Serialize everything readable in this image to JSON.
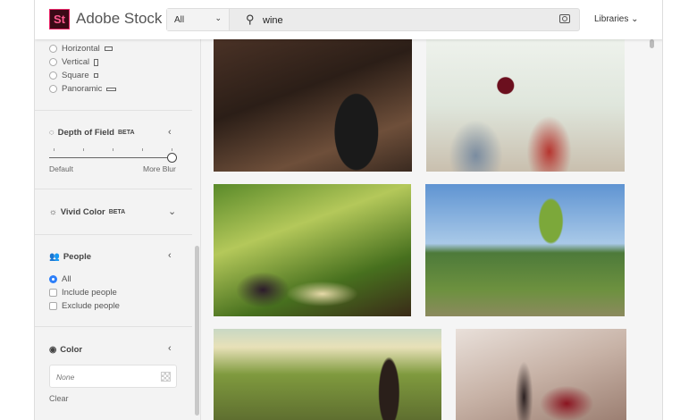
{
  "header": {
    "logo": "St",
    "brand": "Adobe Stock",
    "filter": "All",
    "query": "wine",
    "libraries": "Libraries"
  },
  "sidebar": {
    "orientation": [
      "Horizontal",
      "Vertical",
      "Square",
      "Panoramic"
    ],
    "depth": {
      "title": "Depth of Field",
      "badge": "BETA",
      "min": "Default",
      "max": "More Blur",
      "value": 1.0
    },
    "vivid": {
      "title": "Vivid Color",
      "badge": "BETA"
    },
    "people": {
      "title": "People",
      "options": [
        "All",
        "Include people",
        "Exclude people"
      ]
    },
    "color": {
      "title": "Color",
      "value": "None",
      "clear": "Clear"
    }
  },
  "results": [
    {
      "subject": "corkscrew opening wine bottle"
    },
    {
      "subject": "couple toasting red wine"
    },
    {
      "subject": "wine and cheese in vineyard"
    },
    {
      "subject": "grapes in wine glass over field"
    },
    {
      "subject": "wine bottle on vineyard table"
    },
    {
      "subject": "pouring red wine"
    }
  ]
}
